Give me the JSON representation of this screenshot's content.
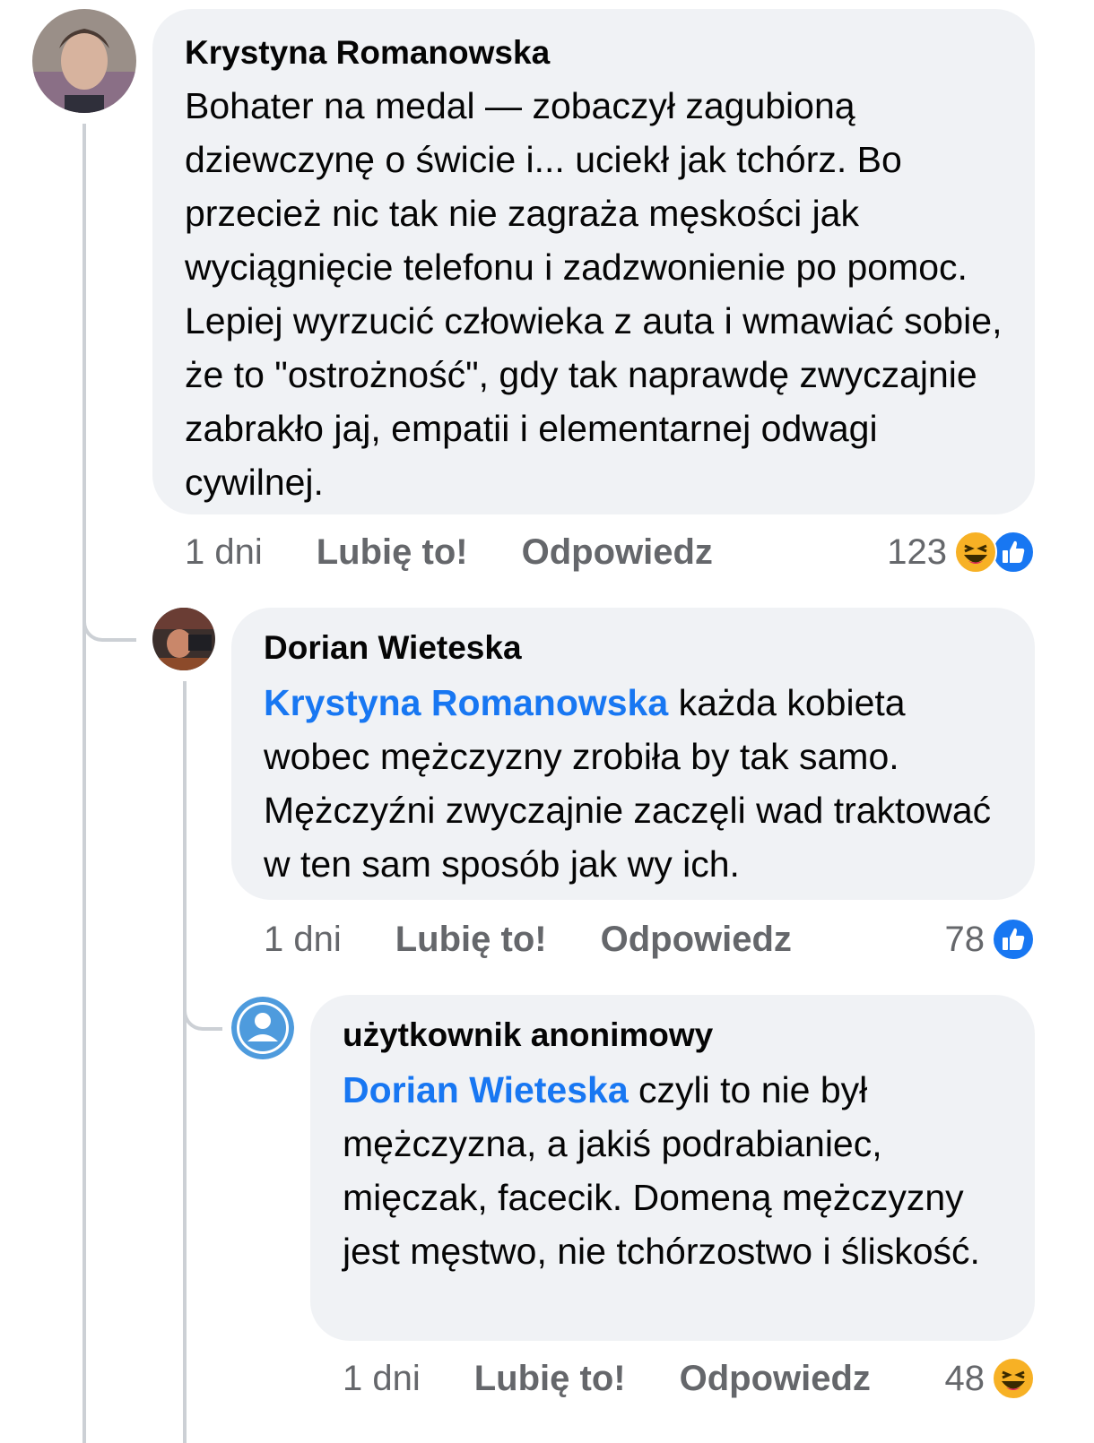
{
  "comments": [
    {
      "author": "Krystyna Romanowska",
      "mention": "",
      "text": "Bohater na medal — zobaczył zagubioną dziewczynę o świcie i... uciekł jak tchórz. Bo przecież nic tak nie zagraża męskości jak wyciągnięcie telefonu i zadzwonienie po pomoc. Lepiej wyrzucić człowieka z auta i wmawiać sobie, że to \"ostrożność\", gdy tak naprawdę zwyczajnie zabrakło jaj, empatii i elementarnej odwagi cywilnej.",
      "time": "1 dni",
      "like_label": "Lubię to!",
      "reply_label": "Odpowiedz",
      "reaction_count": "123",
      "reaction_icons": [
        "haha-icon",
        "like-icon"
      ]
    },
    {
      "author": "Dorian Wieteska",
      "mention": "Krystyna Romanowska",
      "text": " każda kobieta wobec mężczyzny zrobiła by tak samo. Mężczyźni zwyczajnie zaczęli wad traktować w ten sam sposób jak wy ich.",
      "time": "1 dni",
      "like_label": "Lubię to!",
      "reply_label": "Odpowiedz",
      "reaction_count": "78",
      "reaction_icons": [
        "like-icon"
      ]
    },
    {
      "author": "użytkownik anonimowy",
      "mention": "Dorian Wieteska",
      "text": " czyli to nie był mężczyzna, a jakiś podrabianiec, mięczak, facecik. Domeną mężczyzny jest męstwo, nie tchórzostwo i śliskość.",
      "time": "1 dni",
      "like_label": "Lubię to!",
      "reply_label": "Odpowiedz",
      "reaction_count": "48",
      "reaction_icons": [
        "haha-icon"
      ]
    }
  ],
  "colors": {
    "bubble": "#f0f2f5",
    "mention": "#1877f2",
    "meta": "#65676b",
    "like_blue": "#1877f2",
    "haha_yellow": "#f7b125",
    "thread_line": "#ccd0d5"
  }
}
